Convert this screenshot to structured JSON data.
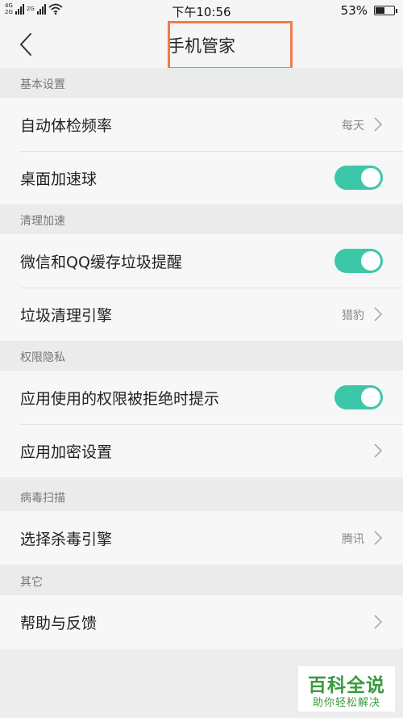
{
  "status_bar": {
    "net_top": "4G",
    "net_bottom": "2G",
    "net_top_2": "2G",
    "time": "下午10:56",
    "battery_percent": "53%",
    "battery_level": 0.53
  },
  "header": {
    "title": "手机管家"
  },
  "sections": [
    {
      "title": "基本设置",
      "rows": [
        {
          "label": "自动体检频率",
          "value": "每天",
          "type": "link"
        },
        {
          "label": "桌面加速球",
          "type": "toggle",
          "on": true
        }
      ]
    },
    {
      "title": "清理加速",
      "rows": [
        {
          "label": "微信和QQ缓存垃圾提醒",
          "type": "toggle",
          "on": true
        },
        {
          "label": "垃圾清理引擎",
          "value": "猎豹",
          "type": "link"
        }
      ]
    },
    {
      "title": "权限隐私",
      "rows": [
        {
          "label": "应用使用的权限被拒绝时提示",
          "type": "toggle",
          "on": true
        },
        {
          "label": "应用加密设置",
          "type": "link"
        }
      ]
    },
    {
      "title": "病毒扫描",
      "rows": [
        {
          "label": "选择杀毒引擎",
          "value": "腾讯",
          "type": "link"
        }
      ]
    },
    {
      "title": "其它",
      "rows": [
        {
          "label": "帮助与反馈",
          "type": "link"
        }
      ]
    }
  ],
  "colors": {
    "toggle_on": "#3cc8a8",
    "highlight_box": "#f07a4e",
    "watermark": "#3a9a3f"
  },
  "watermark": {
    "title": "百科全说",
    "subtitle": "助你轻松解决"
  }
}
